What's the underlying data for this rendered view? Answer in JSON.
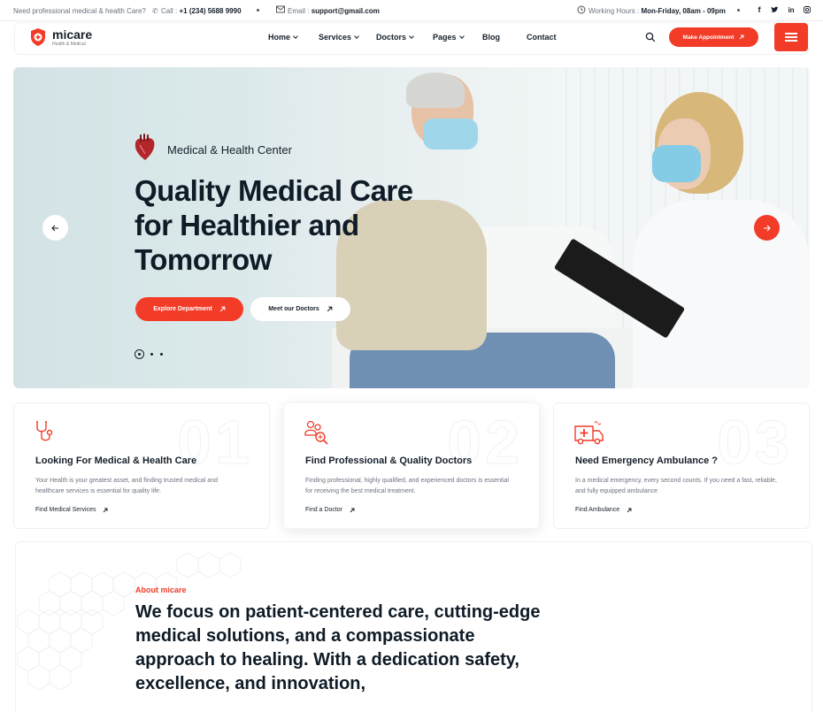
{
  "topbar": {
    "tagline": "Need professional medical & health Care?",
    "call_label": "Call :",
    "call_number": "+1 (234) 5688 9990",
    "email_label": "Email :",
    "email": "support@gmail.com",
    "hours_label": "Working Hours :",
    "hours": "Mon-Friday, 08am - 09pm",
    "social": [
      "facebook-icon",
      "twitter-icon",
      "linkedin-icon",
      "instagram-icon"
    ]
  },
  "brand": {
    "name": "micare",
    "tagline": "Health & Medical",
    "accent": "#f23c28"
  },
  "nav": {
    "items": [
      {
        "label": "Home",
        "dropdown": true
      },
      {
        "label": "Services",
        "dropdown": true
      },
      {
        "label": "Doctors",
        "dropdown": true
      },
      {
        "label": "Pages",
        "dropdown": true
      },
      {
        "label": "Blog",
        "dropdown": false
      },
      {
        "label": "Contact",
        "dropdown": false
      }
    ],
    "cta_label": "Make Appointment"
  },
  "hero": {
    "eyebrow": "Medical & Health Center",
    "title": "Quality Medical Care for Healthier and Tomorrow",
    "primary_btn": "Explore Department",
    "secondary_btn": "Meet our Doctors",
    "slide_count": 3,
    "active_slide": 1
  },
  "cards": [
    {
      "icon": "stethoscope-icon",
      "number": "01",
      "title": "Looking For Medical & Health Care",
      "text": "Your Health is your greatest asset, and finding trusted medical and healthcare services is essential for quality life.",
      "link": "Find Medical Services"
    },
    {
      "icon": "doctors-search-icon",
      "number": "02",
      "title": "Find Professional & Quality Doctors",
      "text": "Finding professional, highly qualified, and experienced doctors is essential for receiving the best medical treatment.",
      "link": "Find a Doctor"
    },
    {
      "icon": "ambulance-icon",
      "number": "03",
      "title": "Need Emergency Ambulance ?",
      "text": "In a medical emergency, every second counts. If you need a fast, reliable, and fully equipped ambulance",
      "link": "Find Ambulance"
    }
  ],
  "about": {
    "eyebrow": "About micare",
    "title": "We focus on patient-centered care, cutting-edge medical solutions, and a compassionate approach to healing. With a dedication safety, excellence, and innovation,"
  }
}
